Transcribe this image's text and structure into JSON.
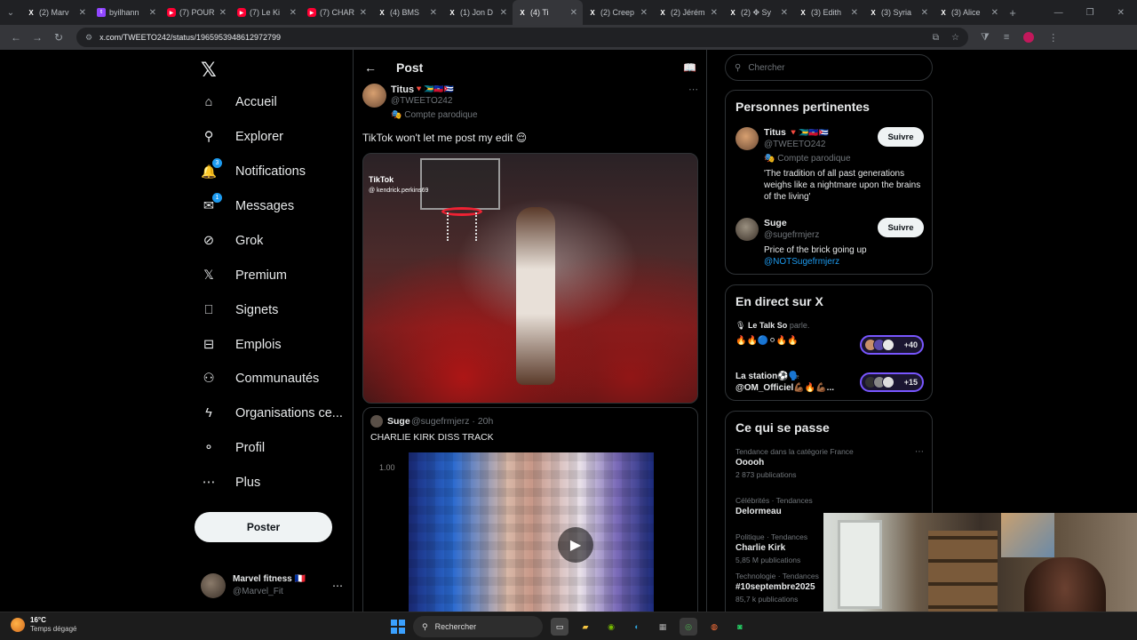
{
  "browser": {
    "tabs": [
      {
        "label": "(2) Marv",
        "icon": "x-icon",
        "fav": "X"
      },
      {
        "label": "byilhann",
        "icon": "twitch-icon",
        "fav": "t"
      },
      {
        "label": "(7) POUR",
        "icon": "youtube-icon",
        "fav": "▶"
      },
      {
        "label": "(7) Le Ki",
        "icon": "youtube-icon",
        "fav": "▶"
      },
      {
        "label": "(7) CHAR",
        "icon": "youtube-icon",
        "fav": "▶"
      },
      {
        "label": "(4) BMS",
        "icon": "x-icon",
        "fav": "X"
      },
      {
        "label": "(1) Jon D",
        "icon": "x-icon",
        "fav": "X"
      },
      {
        "label": "(4) Ti",
        "icon": "x-icon",
        "fav": "X"
      },
      {
        "label": "(2) Creep",
        "icon": "x-icon",
        "fav": "X"
      },
      {
        "label": "(2) Jérém",
        "icon": "x-icon",
        "fav": "X"
      },
      {
        "label": "(2) ✥ Sy",
        "icon": "x-icon",
        "fav": "X"
      },
      {
        "label": "(3) Edith",
        "icon": "x-icon",
        "fav": "X"
      },
      {
        "label": "(3) Syria",
        "icon": "x-icon",
        "fav": "X"
      },
      {
        "label": "(3) Alice",
        "icon": "x-icon",
        "fav": "X"
      }
    ],
    "active_tab_index": 7,
    "url": "x.com/TWEETO242/status/1965953948612972799"
  },
  "nav": {
    "logo": "𝕏",
    "items": [
      {
        "label": "Accueil",
        "icon": "home-icon",
        "glyph": "⌂"
      },
      {
        "label": "Explorer",
        "icon": "search-icon",
        "glyph": "⚲"
      },
      {
        "label": "Notifications",
        "icon": "bell-icon",
        "glyph": "🔔",
        "badge": "3"
      },
      {
        "label": "Messages",
        "icon": "mail-icon",
        "glyph": "✉",
        "badge": "1"
      },
      {
        "label": "Grok",
        "icon": "grok-icon",
        "glyph": "⊘"
      },
      {
        "label": "Premium",
        "icon": "x-icon",
        "glyph": "𝕏"
      },
      {
        "label": "Signets",
        "icon": "bookmark-icon",
        "glyph": "⎕"
      },
      {
        "label": "Emplois",
        "icon": "briefcase-icon",
        "glyph": "⊟"
      },
      {
        "label": "Communautés",
        "icon": "communities-icon",
        "glyph": "⚇"
      },
      {
        "label": "Organisations ce...",
        "icon": "lightning-icon",
        "glyph": "ϟ"
      },
      {
        "label": "Profil",
        "icon": "person-icon",
        "glyph": "⚬"
      },
      {
        "label": "Plus",
        "icon": "more-circle-icon",
        "glyph": "⋯"
      }
    ],
    "post_label": "Poster",
    "account": {
      "name": "Marvel fitness 🇫🇷",
      "handle": "@Marvel_Fit"
    }
  },
  "post": {
    "header_title": "Post",
    "author_name": "Titus",
    "author_flags": "🔻🇧🇸🇭🇹🇨🇺",
    "author_handle": "@TWEETO242",
    "author_label": "Compte parodique",
    "text": "TikTok won't let me post my edit 😌",
    "media": {
      "watermark": "TikTok",
      "tiktok_user": "@ kendrick.perkins69"
    },
    "quote": {
      "name": "Suge",
      "meta": "@sugefrmjerz · 20h",
      "text": "CHARLIE KIRK DISS TRACK",
      "overlay_num": "1.00"
    }
  },
  "search": {
    "placeholder": "Chercher"
  },
  "relevant": {
    "title": "Personnes pertinentes",
    "people": [
      {
        "name": "Titus",
        "flags": "🔻🇧🇸🇭🇹🇨🇺",
        "handle": "@TWEETO242",
        "label": "Compte parodique",
        "bio": "'The tradition of all past generations weighs like a nightmare upon the brains of the living'",
        "link": "",
        "follow": "Suivre"
      },
      {
        "name": "Suge",
        "flags": "",
        "handle": "@sugefrmjerz",
        "label": "",
        "bio": "Price of the brick going up",
        "link": "@NOTSugefrmjerz",
        "follow": "Suivre"
      }
    ]
  },
  "live": {
    "title": "En direct sur X",
    "spaces": [
      {
        "host": "Le Talk So",
        "status": "parle.",
        "title": "🔥🔥🔵⚪🔥🔥",
        "count": "+40"
      },
      {
        "host": "",
        "status": "",
        "title": "La station⚽🗣️\n@OM_Officiel💪🏾🔥💪🏾...",
        "count": "+15"
      }
    ]
  },
  "trends": {
    "title": "Ce qui se passe",
    "items": [
      {
        "category": "Tendance dans la catégorie France",
        "name": "Ooooh",
        "count": "2 873 publications"
      },
      {
        "category": "Célébrités · Tendances",
        "name": "Delormeau",
        "count": ""
      },
      {
        "category": "Politique · Tendances",
        "name": "Charlie Kirk",
        "count": "5,85 M publications"
      },
      {
        "category": "Technologie · Tendances",
        "name": "#10septembre2025",
        "count": "85,7 k publications"
      }
    ]
  },
  "taskbar": {
    "temp": "16°C",
    "weather": "Temps dégagé",
    "search_label": "Rechercher"
  }
}
